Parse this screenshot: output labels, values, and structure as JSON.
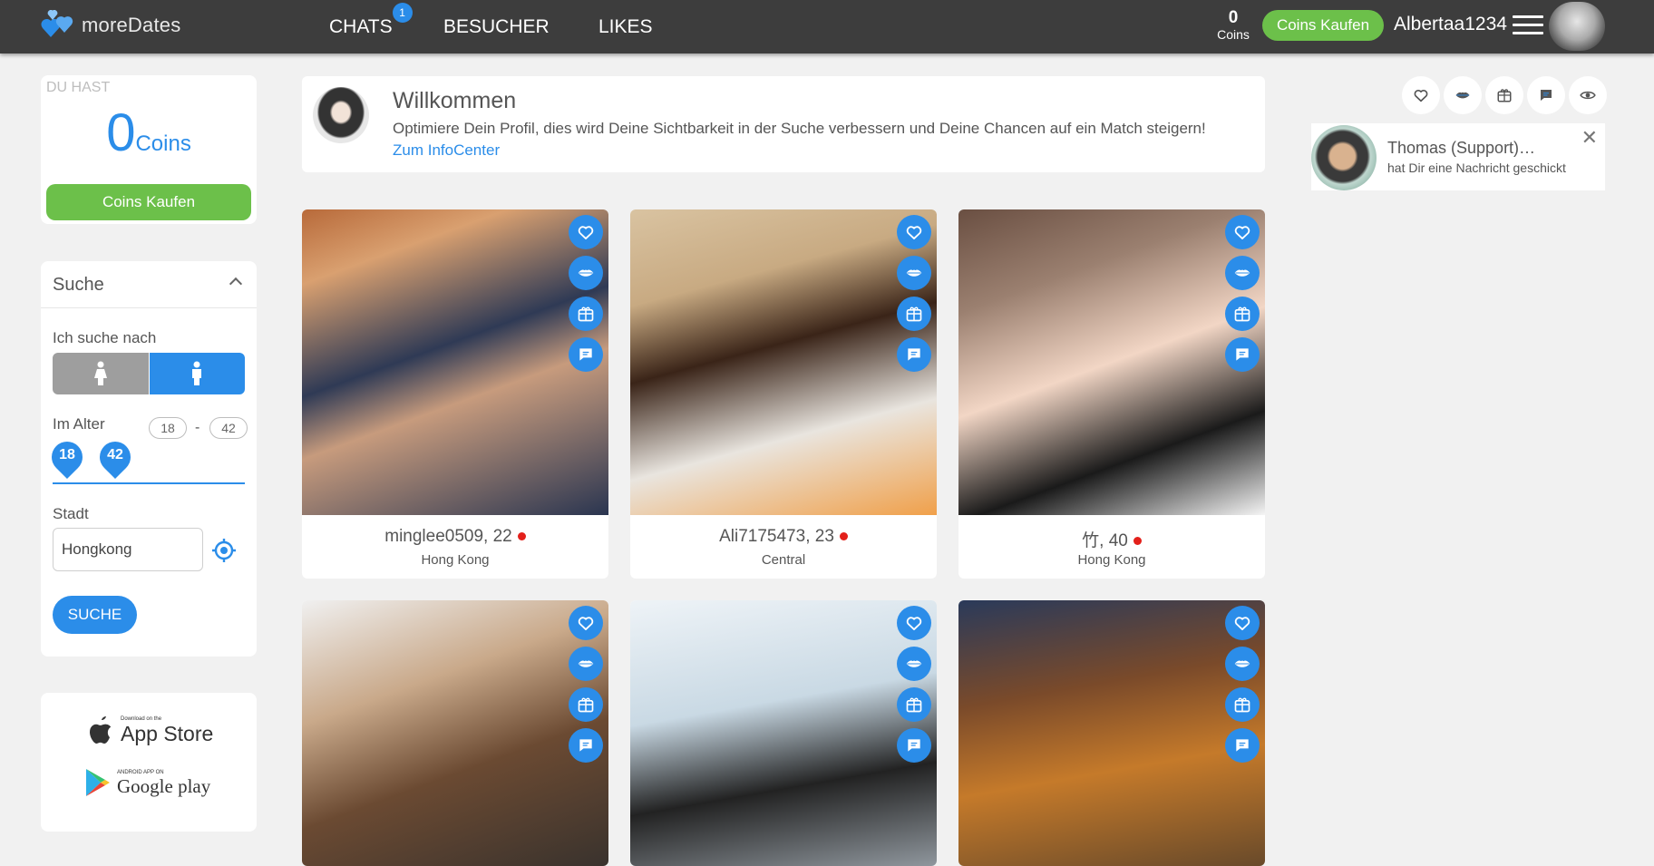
{
  "brand": {
    "name": "moreDates"
  },
  "nav": {
    "chats": "CHATS",
    "chats_badge": "1",
    "visitors": "BESUCHER",
    "likes": "LIKES"
  },
  "header": {
    "coins_value": "0",
    "coins_label": "Coins",
    "buy_label": "Coins Kaufen",
    "username": "Albertaa1234"
  },
  "coins_card": {
    "title": "DU HAST",
    "value": "0",
    "unit": "Coins",
    "buy_label": "Coins Kaufen"
  },
  "search": {
    "title": "Suche",
    "looking_for_label": "Ich suche nach",
    "selected_gender": "male",
    "age_label": "Im Alter",
    "age_min": "18",
    "age_max": "42",
    "city_label": "Stadt",
    "city_value": "Hongkong",
    "submit_label": "SUCHE"
  },
  "apps": {
    "appstore_small": "Download on the",
    "appstore": "App Store",
    "googleplay_small": "ANDROID APP ON",
    "googleplay": "Google play"
  },
  "welcome": {
    "title": "Willkommen",
    "text": "Optimiere Dein Profil, dies wird Deine Sichtbarkeit in der Suche verbessern und Deine Chancen auf ein Match steigern!",
    "link": "Zum InfoCenter"
  },
  "profiles": [
    {
      "name": "minglee0509, 22",
      "city": "Hong Kong"
    },
    {
      "name": "Ali7175473, 23",
      "city": "Central"
    },
    {
      "name": "竹, 40",
      "city": "Hong Kong"
    },
    {
      "name": "",
      "city": ""
    },
    {
      "name": "",
      "city": ""
    },
    {
      "name": "",
      "city": ""
    }
  ],
  "profile_actions": [
    "heart-icon",
    "kiss-icon",
    "gift-icon",
    "chat-icon"
  ],
  "right_icons": [
    "heart-icon",
    "kiss-icon",
    "gift-icon",
    "chat-icon",
    "eye-icon"
  ],
  "notification": {
    "title": "Thomas (Support)…",
    "text": "hat Dir eine Nachricht geschickt"
  },
  "colors": {
    "accent": "#2b8de9",
    "green": "#6cc04a",
    "header_bg": "#3d3d3d",
    "online_dot": "#e3201b"
  }
}
